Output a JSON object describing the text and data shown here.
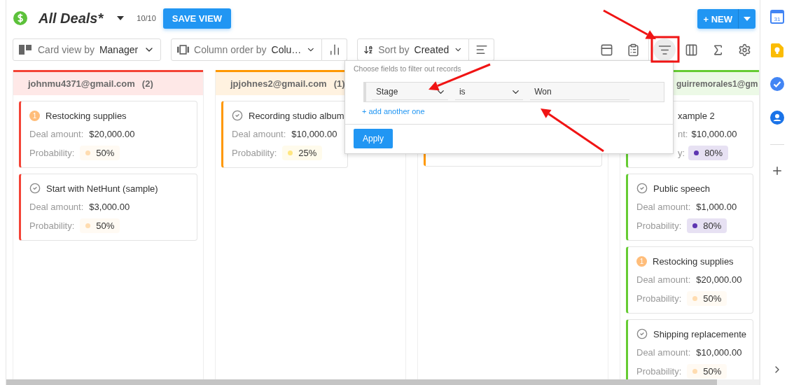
{
  "app": {
    "title": "All Deals*",
    "count": "10/10",
    "save_button": "SAVE VIEW",
    "new_button": "+ NEW"
  },
  "toolbar": {
    "card_view": {
      "label": "Card view by",
      "value": "Manager"
    },
    "column_order": {
      "label": "Column order by",
      "value": "Colu…"
    },
    "sort": {
      "label": "Sort by",
      "value": "Created"
    },
    "tools": [
      {
        "kind": "layout",
        "selected": false
      },
      {
        "kind": "clipboard",
        "selected": false
      },
      {
        "kind": "filter",
        "selected": true
      },
      {
        "kind": "columns",
        "selected": false
      },
      {
        "kind": "sum",
        "selected": false
      },
      {
        "kind": "settings",
        "selected": false
      }
    ]
  },
  "filter_popup": {
    "hint": "Choose fields to filter out records",
    "rule": {
      "field": "Stage",
      "operator": "is",
      "value": "Won"
    },
    "add_link": "+ add another one",
    "apply": "Apply"
  },
  "columns": [
    {
      "title": "johnmu4371@gmail.com",
      "count": "(2)",
      "color": "#f44336",
      "clipped": false,
      "cards": [
        {
          "completed": false,
          "badge": "1",
          "title": "Restocking supplies",
          "amount_label": "Deal amount:",
          "amount": "$20,000.00",
          "probability_label": "Probability:",
          "probability": "50%",
          "color": "#ffdcb0"
        },
        {
          "completed": true,
          "title": "Start with NetHunt (sample)",
          "amount_label": "Deal amount:",
          "amount": "$3,000.00",
          "probability_label": "Probability:",
          "probability": "50%",
          "color": "#ffdcb0"
        }
      ]
    },
    {
      "title": "jpjohnes2@gmail.com",
      "count": "(1)",
      "color": "#ff9800",
      "clipped": false,
      "cards": [
        {
          "completed": true,
          "title": "Recording studio album",
          "amount_label": "Deal amount:",
          "amount": "$10,000.00",
          "probability_label": "Probability:",
          "probability": "25%",
          "color": "#ffe680"
        }
      ]
    },
    {
      "color": "#ff9800"
    },
    {
      "title": "guirremorales1@gm",
      "color": "#66cc33",
      "clipped": true,
      "cards": [
        {
          "clipped": true,
          "title": "xample 2",
          "amount_label": "nt:",
          "amount": "$10,000.00",
          "probability_label": "y:",
          "probability": "80%",
          "color": "#5e35b1"
        },
        {
          "completed": true,
          "title": "Public speech",
          "amount_label": "Deal amount:",
          "amount": "$1,000.00",
          "probability_label": "Probability:",
          "probability": "80%",
          "color": "#5e35b1"
        },
        {
          "completed": false,
          "badge": "1",
          "title": "Restocking supplies",
          "amount_label": "Deal amount:",
          "amount": "$20,000.00",
          "probability_label": "Probability:",
          "probability": "50%",
          "color": "#ffdcb0"
        },
        {
          "completed": true,
          "title": "Shipping replacemente",
          "amount_label": "Deal amount:",
          "amount": "$10,000.00",
          "probability_label": "Probability:",
          "probability": "50%",
          "color": "#ffdcb0"
        }
      ]
    }
  ],
  "side_apps": [
    {
      "kind": "calendar",
      "day": "31"
    },
    {
      "kind": "keep"
    },
    {
      "kind": "tasks"
    },
    {
      "kind": "contacts"
    }
  ]
}
